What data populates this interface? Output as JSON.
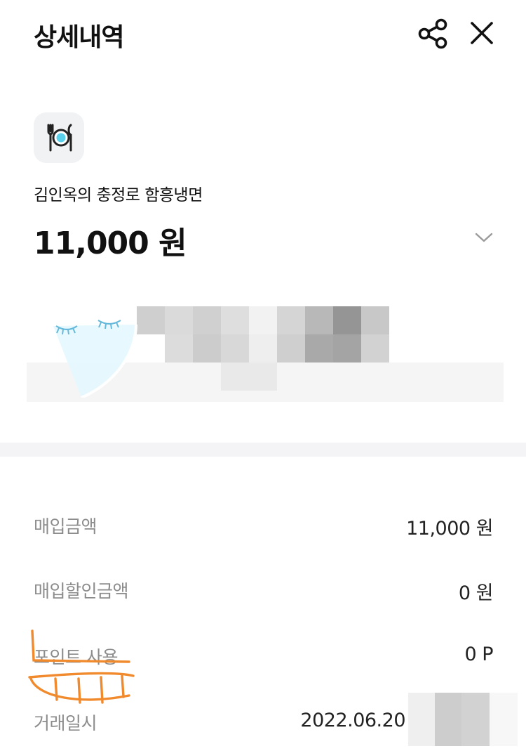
{
  "header": {
    "title": "상세내역",
    "share_icon": "share-icon",
    "close_icon": "close-icon"
  },
  "transaction": {
    "category_icon": "dining-icon",
    "merchant": "김인옥의 충정로 함흥냉면",
    "amount": "11,000 원",
    "expand_icon": "chevron-down-icon"
  },
  "details": [
    {
      "label": "매입금액",
      "value": "11,000 원"
    },
    {
      "label": "매입할인금액",
      "value": "0 원"
    },
    {
      "label": "포인트 사용",
      "value": "0 P"
    },
    {
      "label": "거래일시",
      "value": "2022.06.20"
    }
  ],
  "colors": {
    "background": "#ffffff",
    "divider": "#f4f4f6",
    "label_gray": "#8c8c8c",
    "icon_accent": "#5ad0ea",
    "doodle_orange": "#f08a2c"
  }
}
